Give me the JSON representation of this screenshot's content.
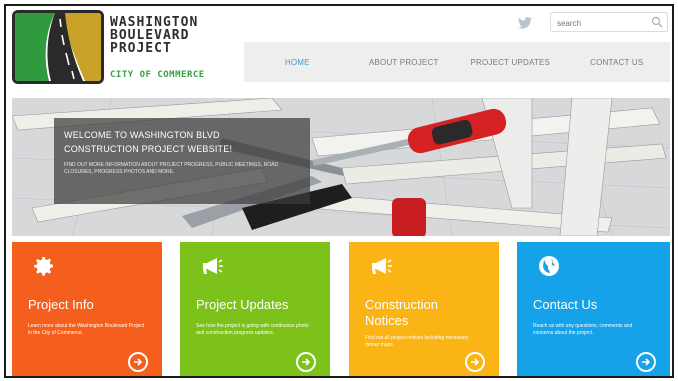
{
  "header": {
    "logo_lines": [
      "WASHINGTON",
      "BOULEVARD",
      "PROJECT"
    ],
    "logo_sub": "CITY OF COMMERCE",
    "search_placeholder": "search"
  },
  "nav": {
    "items": [
      {
        "label": "HOME",
        "active": true
      },
      {
        "label": "ABOUT PROJECT",
        "active": false
      },
      {
        "label": "PROJECT UPDATES",
        "active": false
      },
      {
        "label": "CONTACT US",
        "active": false
      }
    ]
  },
  "hero": {
    "title_line1": "WELCOME TO WASHINGTON BLVD",
    "title_line2": "CONSTRUCTION PROJECT WEBSITE!",
    "subtitle": "FIND OUT MORE INFORMATION ABOUT PROJECT PROGRESS, PUBLIC MEETINGS, ROAD CLOSURES, PROGRESS PHOTOS AND MORE."
  },
  "tiles": [
    {
      "title": "Project Info",
      "desc": "Learn more about the Washington Boulevard Project in the City of Commerce.",
      "icon": "gear-icon",
      "color": "#f45f1e"
    },
    {
      "title": "Project Updates",
      "desc": "See how the project is going with continuous photo and construction progress updates.",
      "icon": "megaphone-icon",
      "color": "#7dc21a"
    },
    {
      "title": "Construction Notices",
      "desc": "Find out all project notices including necessary detour maps.",
      "icon": "megaphone-icon",
      "color": "#fbb415"
    },
    {
      "title": "Contact Us",
      "desc": "Reach us with any questions, comments and concerns about the project.",
      "icon": "globe-icon",
      "color": "#16a2e8"
    }
  ],
  "colors": {
    "nav_active": "#41a0d4",
    "logo_green": "#3aa141",
    "logo_gold": "#c9a227"
  }
}
